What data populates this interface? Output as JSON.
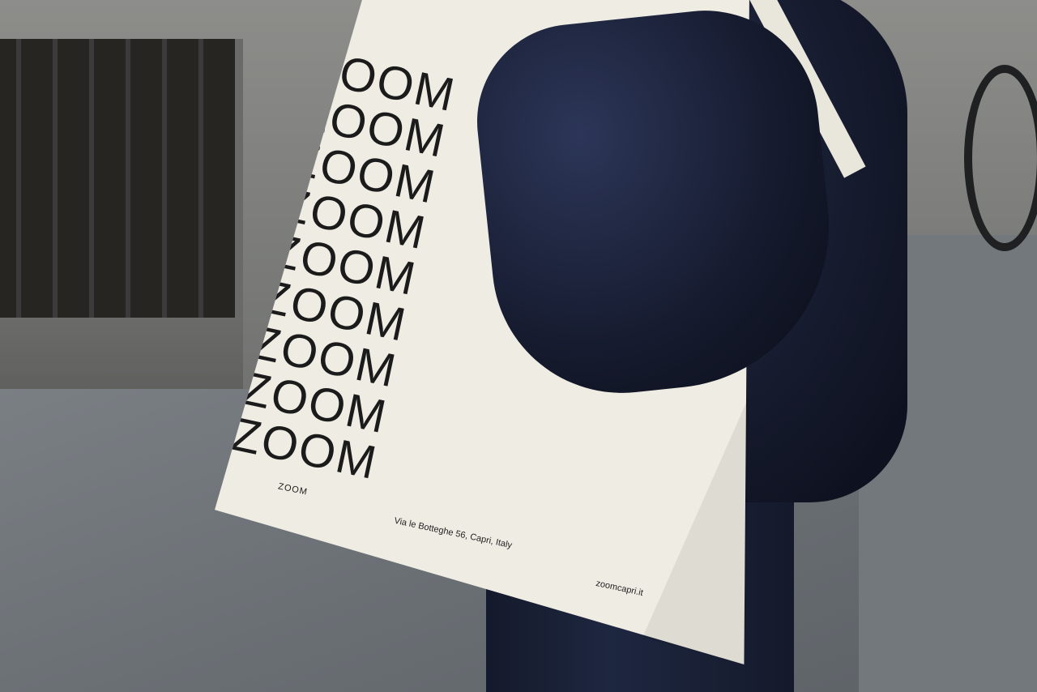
{
  "image": {
    "kind": "photo",
    "subject": "tote-bag-on-shoulder"
  },
  "tote_bag": {
    "zoom_rows": [
      "ZOOM",
      "ZOOM",
      "ZOOM",
      "ZOOM",
      "ZOOM",
      "ZOOM",
      "ZOOM",
      "ZOOM",
      "ZOOM"
    ],
    "brand_small": "ZOOM",
    "address": "Via le Botteghe 56, Capri, Italy",
    "website": "zoomcapri.it"
  },
  "colors": {
    "bag": "#efece4",
    "print": "#1b1b1b",
    "jacket": "#161b2e",
    "pavement": "#6a6f74",
    "wall": "#7b7c7a"
  }
}
